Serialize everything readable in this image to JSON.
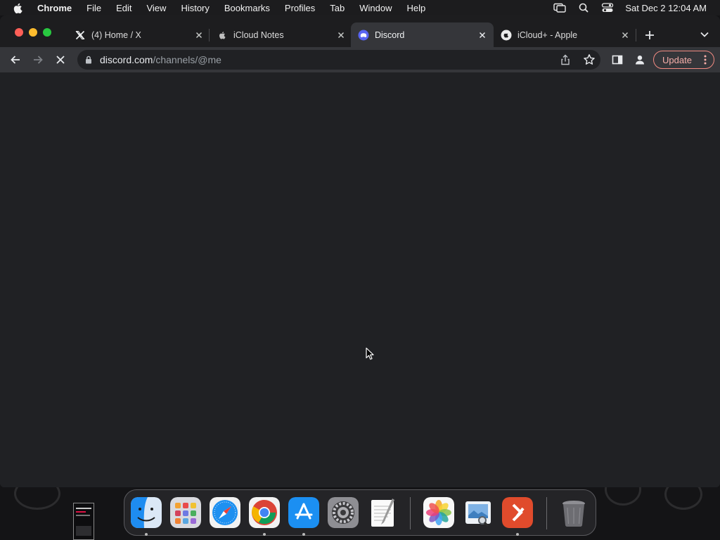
{
  "menubar": {
    "app_name": "Chrome",
    "items": [
      "File",
      "Edit",
      "View",
      "History",
      "Bookmarks",
      "Profiles",
      "Tab",
      "Window",
      "Help"
    ],
    "status_icons": [
      "screen-mirroring-icon",
      "spotlight-search-icon",
      "control-center-icon"
    ],
    "clock": "Sat Dec 2  12:04 AM"
  },
  "browser": {
    "tabs": [
      {
        "title": "(4) Home / X",
        "favicon": "x-logo-icon",
        "active": false
      },
      {
        "title": "iCloud Notes",
        "favicon": "apple-logo-icon",
        "active": false
      },
      {
        "title": "Discord",
        "favicon": "discord-logo-icon",
        "active": true
      },
      {
        "title": "iCloud+ - Apple",
        "favicon": "icloud-icon",
        "active": false
      }
    ],
    "url_host": "discord.com",
    "url_path": "/channels/@me",
    "update_label": "Update",
    "loading": true
  },
  "dock": {
    "apps": [
      {
        "name": "Finder",
        "icon": "finder-icon",
        "running": true
      },
      {
        "name": "Launchpad",
        "icon": "launchpad-icon",
        "running": false
      },
      {
        "name": "Safari",
        "icon": "safari-icon",
        "running": false
      },
      {
        "name": "Google Chrome",
        "icon": "chrome-icon",
        "running": true
      },
      {
        "name": "App Store",
        "icon": "app-store-icon",
        "running": true
      },
      {
        "name": "System Settings",
        "icon": "system-settings-icon",
        "running": false
      },
      {
        "name": "TextEdit",
        "icon": "textedit-icon",
        "running": false
      },
      {
        "name": "Photos",
        "icon": "photos-icon",
        "running": false
      },
      {
        "name": "Preview",
        "icon": "preview-icon",
        "running": false
      },
      {
        "name": "Microsoft Remote Desktop",
        "icon": "remote-desktop-icon",
        "running": true
      },
      {
        "name": "Trash",
        "icon": "trash-icon",
        "running": false
      }
    ]
  },
  "colors": {
    "viewport_bg": "#202124",
    "toolbar_bg": "#35363a",
    "tabstrip_bg": "#1d1d1f",
    "update_accent": "#f28b82"
  }
}
